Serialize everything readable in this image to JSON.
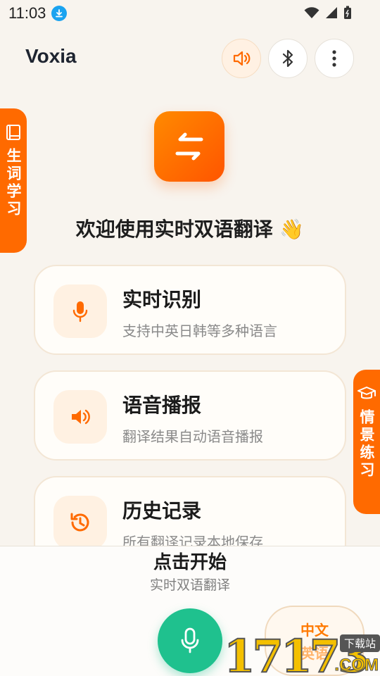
{
  "status": {
    "time": "11:03"
  },
  "header": {
    "title": "Voxia"
  },
  "side_tabs": {
    "vocab": "生词学习",
    "scenario": "情景练习"
  },
  "hero": {
    "welcome": "欢迎使用实时双语翻译 👋"
  },
  "features": [
    {
      "title": "实时识别",
      "subtitle": "支持中英日韩等多种语言",
      "icon": "microphone-icon"
    },
    {
      "title": "语音播报",
      "subtitle": "翻译结果自动语音播报",
      "icon": "speaker-icon"
    },
    {
      "title": "历史记录",
      "subtitle": "所有翻译记录本地保存",
      "icon": "history-icon"
    }
  ],
  "bottom": {
    "start_title": "点击开始",
    "start_subtitle": "实时双语翻译",
    "lang_from": "中文",
    "lang_to": "英语"
  },
  "watermark": {
    "digits": "17173",
    "tag": "下载站",
    "domain": ".COM"
  },
  "colors": {
    "accent": "#ff6a00",
    "fab": "#1fc18e",
    "background": "#f8f4ee"
  }
}
